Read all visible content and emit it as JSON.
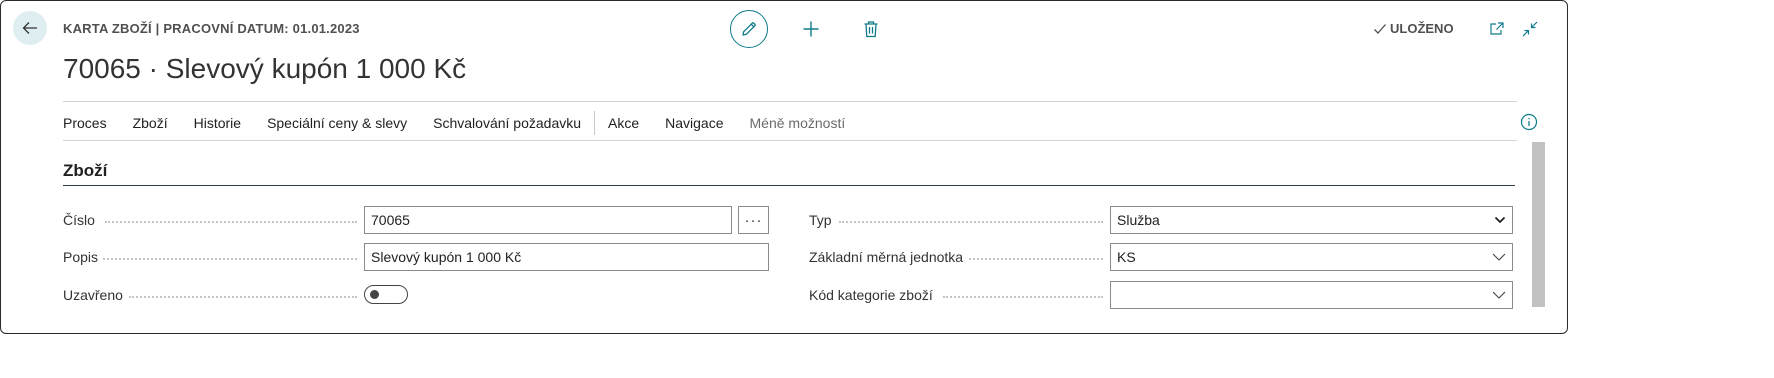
{
  "header": {
    "caption": "KARTA ZBOŽÍ | PRACOVNÍ DATUM: 01.01.2023",
    "title": "70065 · Slevový kupón 1 000 Kč",
    "saved_label": "ULOŽENO"
  },
  "menu": {
    "items": [
      "Proces",
      "Zboží",
      "Historie",
      "Speciální ceny & slevy",
      "Schvalování požadavku"
    ],
    "items_after_sep": [
      "Akce",
      "Navigace"
    ],
    "less_label": "Méně možností"
  },
  "section": {
    "title": "Zboží"
  },
  "fields": {
    "cislo": {
      "label": "Číslo",
      "value": "70065"
    },
    "popis": {
      "label": "Popis",
      "value": "Slevový kupón 1 000 Kč"
    },
    "uzavreno": {
      "label": "Uzavřeno",
      "value": false
    },
    "typ": {
      "label": "Typ",
      "value": "Služba"
    },
    "zakladni_jednotka": {
      "label": "Základní měrná jednotka",
      "value": "KS"
    },
    "kategorie": {
      "label": "Kód kategorie zboží",
      "value": ""
    },
    "more_label": "···"
  },
  "icons": {
    "back": "arrow-left-icon",
    "edit": "pencil-icon",
    "add": "plus-icon",
    "delete": "trash-icon",
    "saved": "checkmark-icon",
    "open_new": "open-in-new-window-icon",
    "collapse": "collapse-icon",
    "info": "info-icon"
  },
  "colors": {
    "accent": "#0f7b8a",
    "back_button_bg": "#dfeff1",
    "section_rule": "#2c3e50"
  }
}
